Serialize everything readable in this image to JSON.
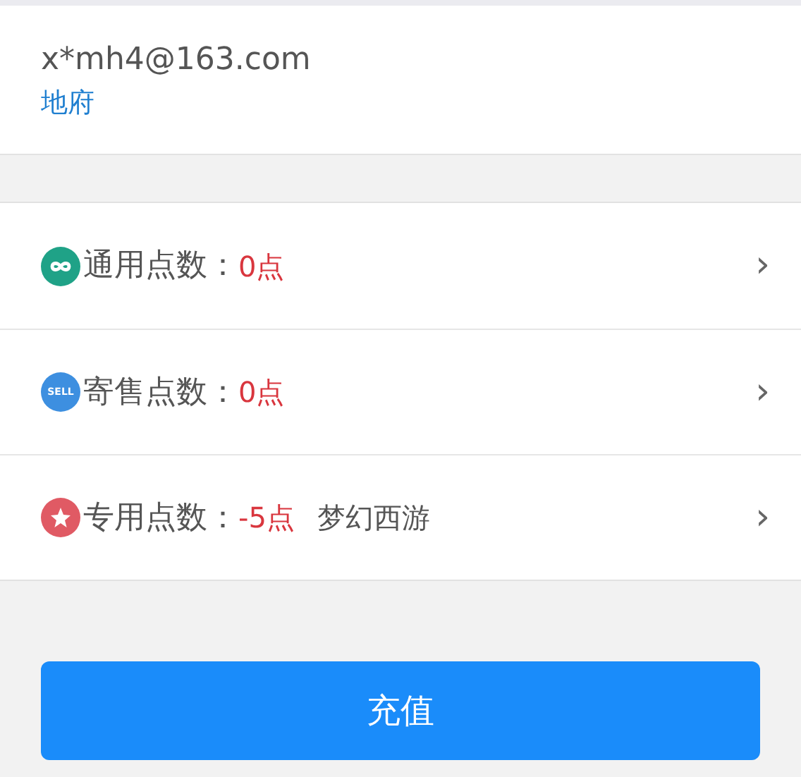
{
  "account": {
    "email": "x*mh4@163.com",
    "server": "地府"
  },
  "points": [
    {
      "kind": "infinity",
      "label": "通用点数：",
      "value": "0点"
    },
    {
      "kind": "sell",
      "icon_text": "SELL",
      "label": "寄售点数：",
      "value": "0点"
    },
    {
      "kind": "star",
      "label": "专用点数：",
      "value": "-5点",
      "game": "梦幻西游"
    }
  ],
  "chevron": "›",
  "button": "充值"
}
